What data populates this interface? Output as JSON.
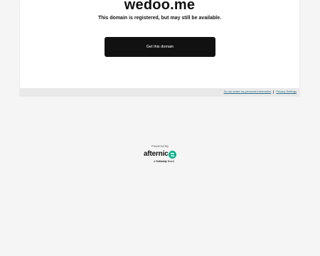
{
  "main": {
    "domain": "wedoo.me",
    "subtitle": "This domain is registered, but may still be available.",
    "cta_label": "Get this domain"
  },
  "footer": {
    "privacy_link": "Do not share my personal information",
    "settings_link": "Privacy Settings"
  },
  "branding": {
    "powered_by": "Powered By",
    "logo_text": "afternic",
    "tagline_prefix": "A",
    "tagline_brand": "GoDaddy",
    "tagline_suffix": "Brand"
  },
  "colors": {
    "cta_background": "#111111",
    "logo_accent": "#00b289",
    "link": "#2f6f8f"
  },
  "icons": [
    "afternic-logo-icon"
  ]
}
